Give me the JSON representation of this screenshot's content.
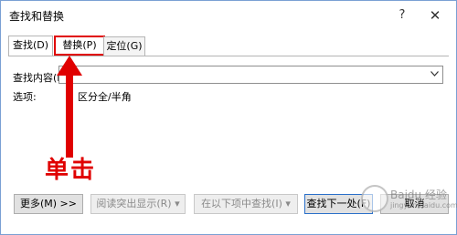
{
  "window": {
    "title": "查找和替换",
    "help": "?",
    "close": "✕"
  },
  "tabs": [
    {
      "label": "查找(D)"
    },
    {
      "label": "替换(P)"
    },
    {
      "label": "定位(G)"
    }
  ],
  "find": {
    "label": "查找内容(N):",
    "value": ""
  },
  "options": {
    "label": "选项:",
    "value": "区分全/半角"
  },
  "annotation": {
    "text": "单击",
    "color": "#e00000"
  },
  "buttons": {
    "more": "更多(M) >>",
    "reading_highlight": "阅读突出显示(R) ▾",
    "find_in": "在以下项中查找(I) ▾",
    "find_next": "查找下一处(F)",
    "cancel": "取消"
  },
  "watermark": {
    "text": "Baidu 经验",
    "sub": "jingyan.baidu.com"
  }
}
